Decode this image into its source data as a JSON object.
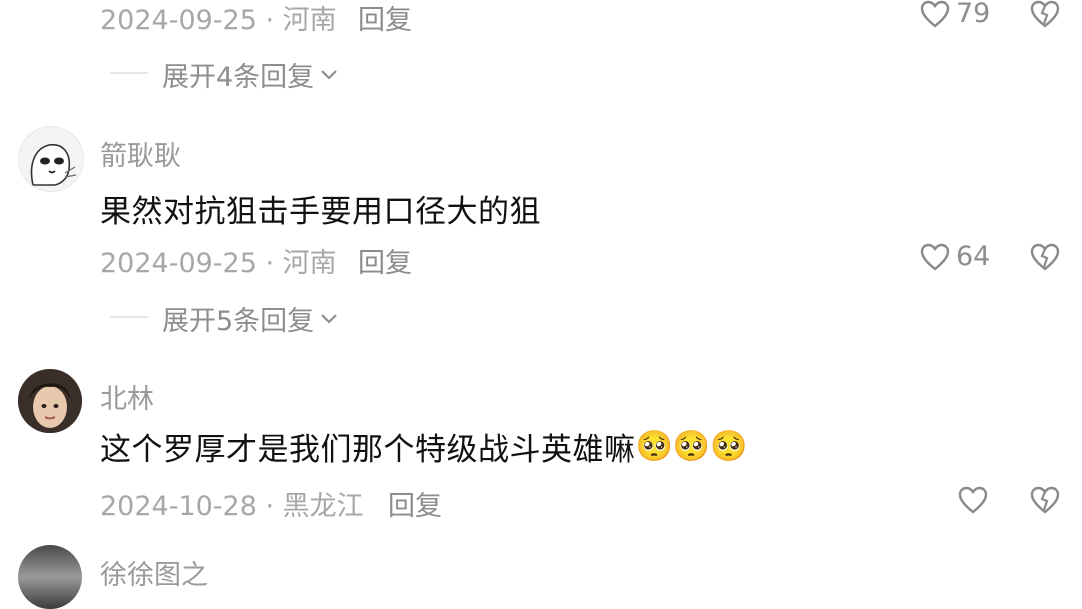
{
  "comments": [
    {
      "meta": "2024-09-25 · 河南",
      "reply_label": "回复",
      "likes": "79",
      "expand_label": "展开4条回复"
    },
    {
      "username": "箭耿耿",
      "content": "果然对抗狙击手要用口径大的狙",
      "meta": "2024-09-25 · 河南",
      "reply_label": "回复",
      "likes": "64",
      "expand_label": "展开5条回复"
    },
    {
      "username": "北林",
      "content": "这个罗厚才是我们那个特级战斗英雄嘛",
      "emojis": [
        "🥺",
        "🥺",
        "🥺"
      ],
      "meta": "2024-10-28 · 黑龙江",
      "reply_label": "回复",
      "likes": ""
    },
    {
      "username": "徐徐图之"
    }
  ],
  "icons": {
    "like": "heart-outline-icon",
    "dislike": "broken-heart-icon",
    "expand": "chevron-down-icon"
  },
  "colors": {
    "meta": "#a7a7a7",
    "content": "#111111",
    "background": "#ffffff"
  }
}
